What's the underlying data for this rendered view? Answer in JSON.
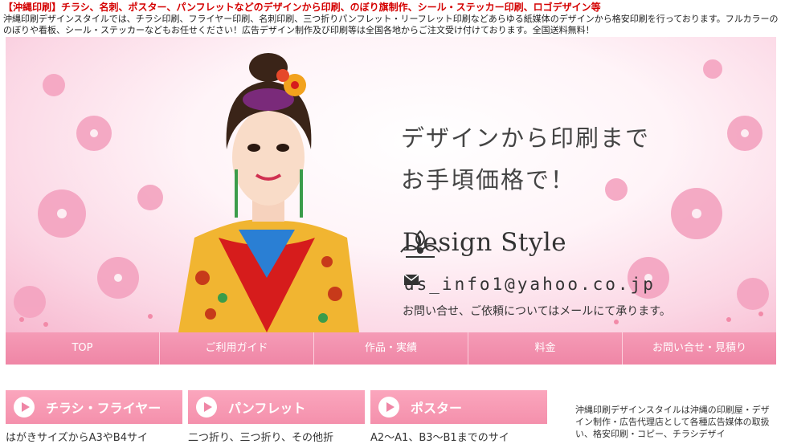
{
  "header": {
    "title": "【沖縄印刷】チラシ、名刺、ポスター、パンフレットなどのデザインから印刷、のぼり旗制作、シール・ステッカー印刷、ロゴデザイン等",
    "intro": "沖縄印刷デザインスタイルでは、チラシ印刷、フライヤー印刷、名刺印刷、三つ折りパンフレット・リーフレット印刷などあらゆる紙媒体のデザインから格安印刷を行っております。フルカラーののぼりや看板、シール・ステッカーなどもお任せください！広告デザイン制作及び印刷等は全国各地からご注文受け付けております。全国送料無料！"
  },
  "hero": {
    "headline_line1": "デザインから印刷まで",
    "headline_line2": "お手頃価格で！",
    "brand_name": "Design Style",
    "email": "ds_info1@yahoo.co.jp",
    "contact_note": "お問い合せ、ご依頼についてはメールにて承ります。",
    "colors": {
      "accent_pink": "#ef86a6",
      "flower_pink": "#f4a3c0"
    }
  },
  "nav": {
    "items": [
      {
        "label": "TOP"
      },
      {
        "label": "ご利用ガイド"
      },
      {
        "label": "作品・実績"
      },
      {
        "label": "料金"
      },
      {
        "label": "お問い合せ・見積り"
      }
    ]
  },
  "categories": [
    {
      "title": "チラシ・フライヤー",
      "desc": "はがきサイズからA3やB4サイ",
      "icon": "play-circle-icon"
    },
    {
      "title": "パンフレット",
      "desc": "二つ折り、三つ折り、その他折",
      "icon": "play-circle-icon"
    },
    {
      "title": "ポスター",
      "desc": "A2〜A1、B3〜B1までのサイ",
      "icon": "play-circle-icon"
    }
  ],
  "sidebar": {
    "text": "沖縄印刷デザインスタイルは沖縄の印刷屋・デザイン制作・広告代理店として各種広告媒体の取扱い、格安印刷・コピー、チラシデザイ"
  }
}
